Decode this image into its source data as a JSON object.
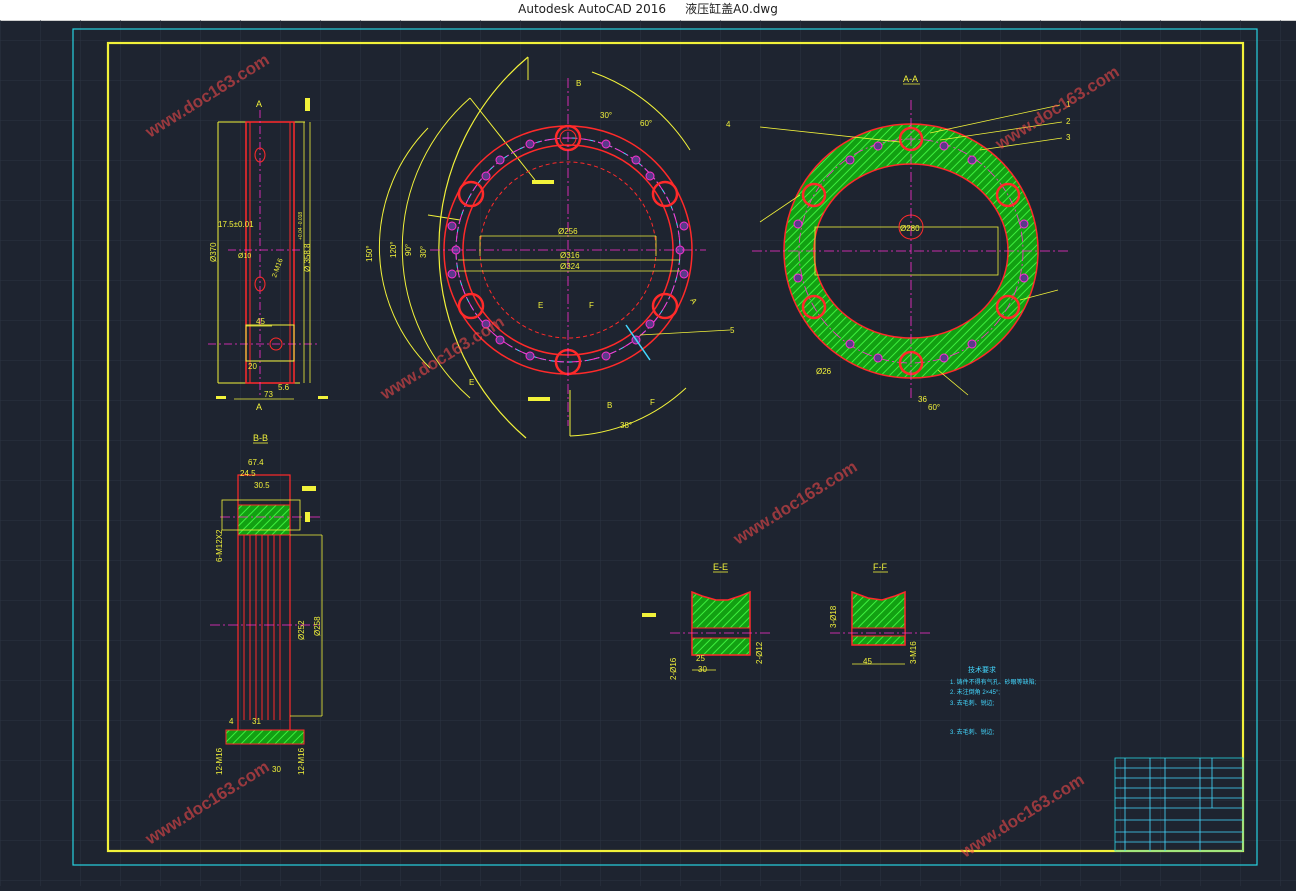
{
  "window": {
    "app_title": "Autodesk AutoCAD 2016",
    "file_title": "液压缸盖A0.dwg"
  },
  "colors": {
    "background": "#1e2430",
    "frame_outer": "#27d3e0",
    "frame_inner": "#f2f23a",
    "part_outline": "#ff2a2a",
    "center_line": "#ff2fd0",
    "dimension": "#f2f23a",
    "hatch": "#18c418",
    "hidden": "#44d8ff",
    "watermark": "#ff5a5a"
  },
  "views": {
    "section_aa": "A-A",
    "section_bb": "B-B",
    "section_ee": "E-E",
    "section_ff": "F-F",
    "mark_a": "A",
    "mark_b": "B",
    "mark_e": "E",
    "mark_f": "F"
  },
  "dims": {
    "d370": "Ø370",
    "d358": "Ø 358.8",
    "tol358": "+0.04 -0.018",
    "d17": "17.5±0.01",
    "d10": "Ø10",
    "m16": "2-M16",
    "d45": "45",
    "d20": "20",
    "d73": "73",
    "d56": "5.6",
    "d256": "Ø256",
    "d316": "Ø316",
    "d324": "Ø324",
    "a30": "30°",
    "a60": "60°",
    "a90": "90°",
    "a120": "120°",
    "a150": "150°",
    "a38": "38°",
    "d280": "Ø280",
    "d26": "Ø26",
    "d36": "36",
    "d674": "67.4",
    "d245": "24.5",
    "d305": "30.5",
    "m12": "6-M12X2",
    "d258": "Ø258",
    "d252": "Ø252",
    "d4": "4",
    "d31": "31",
    "m16b": "12-M16",
    "d30": "30",
    "d25": "25",
    "d16": "2-Ø16",
    "d12": "2-Ø12",
    "d218": "3-Ø18",
    "m16c": "3-M16",
    "c1": "1",
    "c2": "2",
    "c3": "3",
    "c4": "4",
    "c5": "5"
  },
  "notes": {
    "heading": "技术要求",
    "line1": "1. 铸件不得有气孔、砂眼等缺陷;",
    "line2": "2. 未注倒角 2×45°;",
    "line3": "3. 去毛刺、锐边;",
    "line4": "3. 去毛刺、锐边;"
  },
  "watermark": "www.doc163.com"
}
